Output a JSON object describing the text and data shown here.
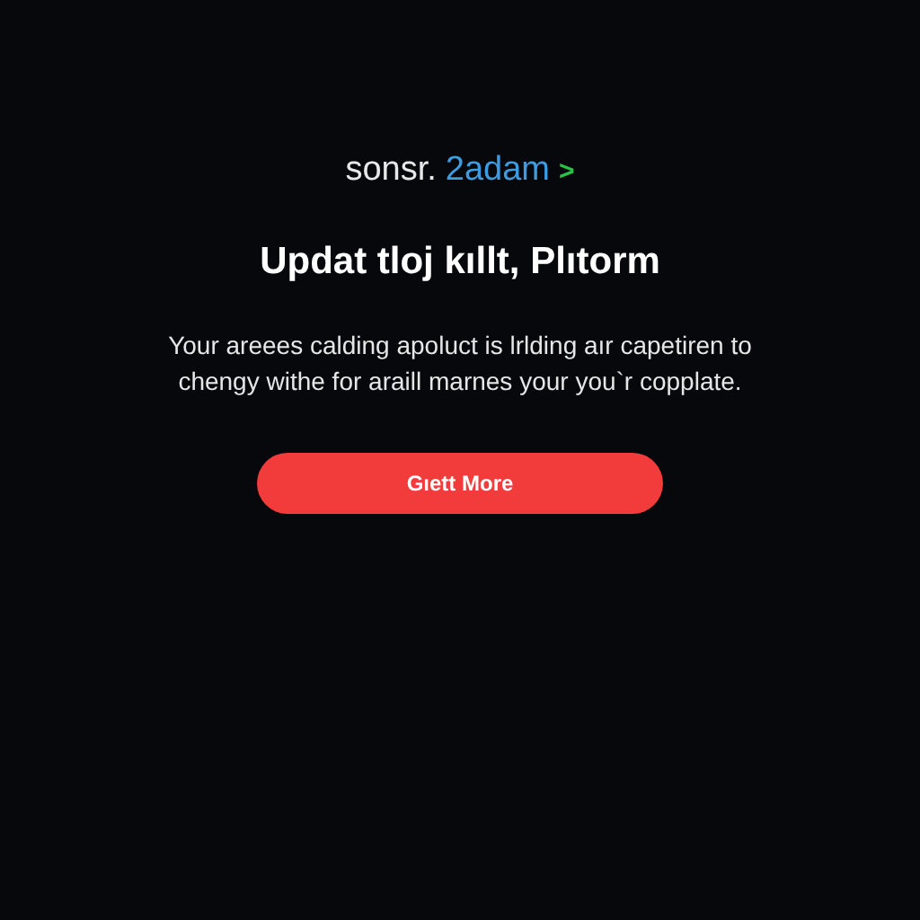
{
  "brand": {
    "prefix": "sonsr.",
    "name": "2adam",
    "arrow": ">"
  },
  "headline": "Updat tloj kıllt, Plıtorm",
  "description": "Your areees calding apoluct is lrlding aır capetiren to chengy withe for araill marnes your you`r copplate.",
  "button": {
    "label": "Gıett More"
  }
}
